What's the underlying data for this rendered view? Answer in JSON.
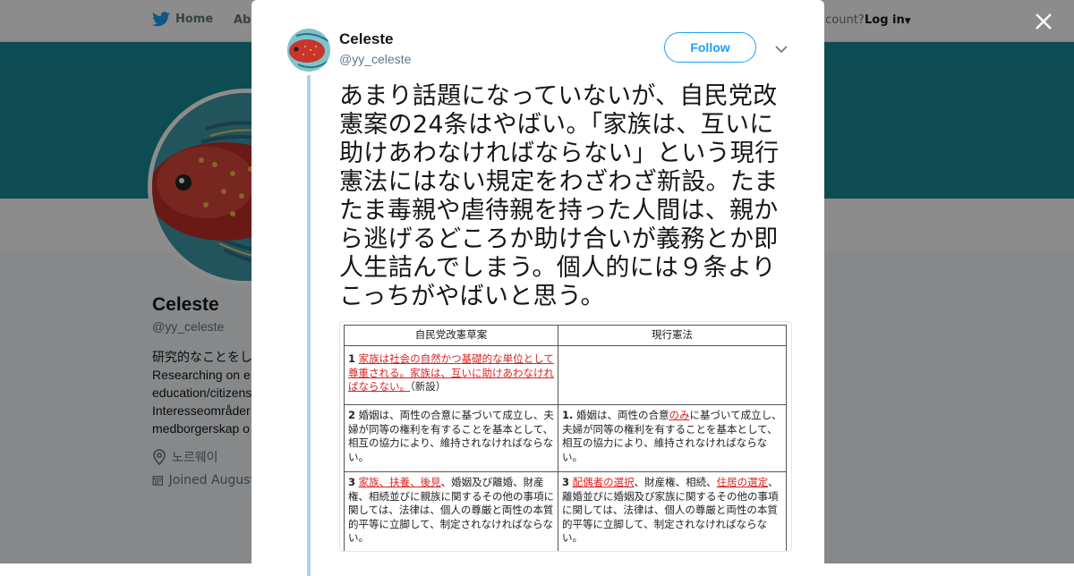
{
  "nav": {
    "home": "Home",
    "about": "Abo",
    "account": "ccount?",
    "login": "Log in"
  },
  "profile": {
    "name": "Celeste",
    "handle": "@yy_celeste",
    "bio_lines": [
      "研究的なことをし",
      "Researching on e",
      "education/citizens",
      "Interesseområder",
      "medborgerskap o"
    ],
    "location": "노르웨이",
    "joined": "Joined August"
  },
  "tweet": {
    "name": "Celeste",
    "handle": "@yy_celeste",
    "follow_label": "Follow",
    "text": "あまり話題になっていないが、自民党改憲案の24条はやばい。「家族は、互いに助けあわなければならない」という現行憲法にはない規定をわざわざ新設。たまたま毒親や虐待親を持った人間は、親から逃げるどころか助け合いが義務とか即人生詰んでしまう。個人的には９条よりこっちがやばいと思う。"
  },
  "image_table": {
    "headers": [
      "自民党改憲草案",
      "現行憲法"
    ],
    "rows": [
      {
        "left_num": "1",
        "left_red": "家族は社会の自然かつ基礎的な単位として尊重される。家族は、互いに助けあわなければならない。",
        "left_rest": "（新設）",
        "right": ""
      },
      {
        "left_num": "2",
        "left_text": "婚姻は、両性の合意に基づいて成立し、夫婦が同等の権利を有することを基本として、相互の協力により、維持されなければならない。",
        "right_num": "1.",
        "right_pre": "婚姻は、両性の合意",
        "right_red": "のみ",
        "right_post": "に基づいて成立し、夫婦が同等の権利を有することを基本として、相互の協力により、維持されなければならない。"
      },
      {
        "left_num": "3",
        "left_red": "家族、扶養、後見",
        "left_rest": "、婚姻及び離婚、財産権、相続並びに親族に関するその他の事項に関しては、法律は、個人の尊厳と両性の本質的平等に立脚して、制定されなければならない。",
        "right_num": "3",
        "right_red1": "配偶者の選択",
        "right_mid": "、財産権、相続、",
        "right_red2": "住居の選定",
        "right_rest": "、離婚並びに婚姻及び家族に関するその他の事項に関しては、法律は、個人の尊厳と両性の本質的平等に立脚して、制定されなければならない。"
      }
    ]
  },
  "colors": {
    "banner": "#1b8a97",
    "accent": "#1da1f2",
    "thread_line": "#a9d7e8",
    "highlight_red": "#dd2222"
  }
}
